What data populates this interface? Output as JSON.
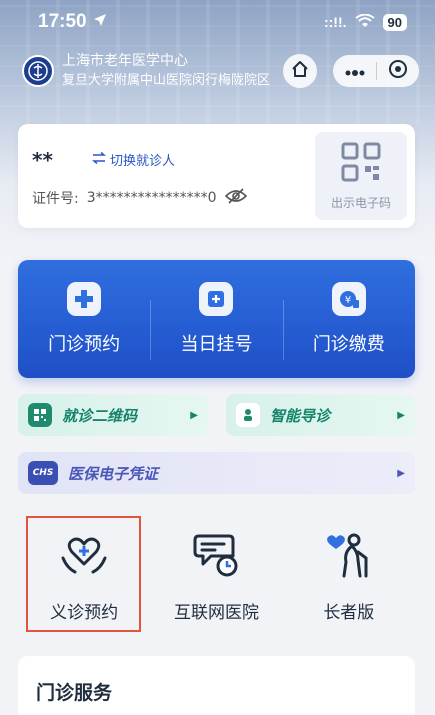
{
  "status_bar": {
    "time": "17:50",
    "signal": "::!!.",
    "battery": "90"
  },
  "header": {
    "hospital_name_line1": "上海市老年医学中心",
    "hospital_name_line2": "复旦大学附属中山医院闵行梅陇院区"
  },
  "patient": {
    "name": "**",
    "switch_label": "切换就诊人",
    "id_label": "证件号:",
    "id_value": "3****************0",
    "qr_label": "出示电子码"
  },
  "quick_actions": [
    {
      "label": "门诊预约",
      "icon": "cross-icon"
    },
    {
      "label": "当日挂号",
      "icon": "register-icon"
    },
    {
      "label": "门诊缴费",
      "icon": "payment-icon"
    }
  ],
  "pills": [
    {
      "label": "就诊二维码",
      "icon": "qrcode-icon",
      "color": "#14856c"
    },
    {
      "label": "智能导诊",
      "icon": "guide-icon",
      "color": "#14856c"
    },
    {
      "label": "医保电子凭证",
      "icon": "chs-icon",
      "color": "#4a57b8",
      "icon_text": "CHS"
    }
  ],
  "services": [
    {
      "label": "义诊预约",
      "icon": "heart-hands-icon"
    },
    {
      "label": "互联网医院",
      "icon": "chat-clock-icon"
    },
    {
      "label": "长者版",
      "icon": "elder-icon"
    }
  ],
  "section": {
    "title": "门诊服务"
  },
  "colors": {
    "primary": "#2b55c9",
    "highlight": "#e2553c"
  }
}
